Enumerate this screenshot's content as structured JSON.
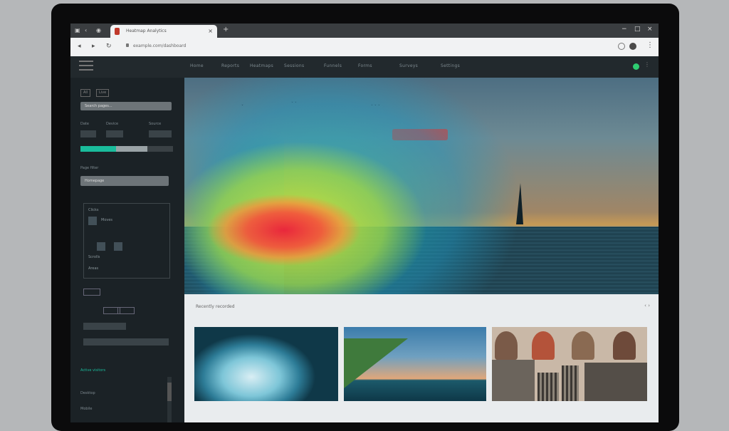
{
  "browser": {
    "tab_title": "Heatmap Analytics",
    "tab_close": "×",
    "new_tab": "+",
    "url": "example.com/dashboard",
    "window_controls": [
      "−",
      "□",
      "×"
    ]
  },
  "app_nav": {
    "links": [
      "Home",
      "Reports",
      "Heatmaps",
      "Sessions",
      "Funnels",
      "Forms",
      "Surveys",
      "Settings"
    ]
  },
  "sidebar": {
    "tags": [
      "All",
      "Live"
    ],
    "search_value": "Search pages...",
    "labels": [
      "Date",
      "Device",
      "Source"
    ],
    "section_label": "Page filter",
    "select_value": "Homepage",
    "panel_rows": [
      "Clicks",
      "Moves",
      "Scrolls",
      "Areas"
    ],
    "footer_label": "Active visitors",
    "footer_rows": [
      "Desktop",
      "Mobile"
    ]
  },
  "progress": {
    "value": 0.7
  },
  "gallery": {
    "title": "Recently recorded",
    "nav": "‹ ›"
  },
  "colors": {
    "accent": "#1abc9c",
    "cta": "#d6413c",
    "status": "#2ecc71"
  },
  "icons": [
    "hamburger-icon",
    "back-icon",
    "forward-icon",
    "reload-icon",
    "lock-icon",
    "kebab-menu-icon",
    "status-dot-icon"
  ]
}
